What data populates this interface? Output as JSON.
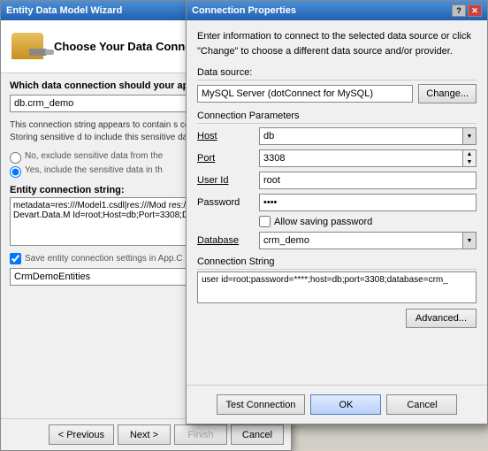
{
  "wizard": {
    "title": "Entity Data Model Wizard",
    "titlebar_buttons": [
      "?",
      "—",
      "✕"
    ],
    "header_title": "Choose Your Data Connection",
    "section_label": "Which data connection should your applic",
    "connection_value": "db.crm_demo",
    "info_text": "This connection string appears to contain s connect to the database. Storing sensitive d to include this sensitive data in the connecti",
    "radio1": "No, exclude sensitive data from the",
    "radio2": "Yes, include the sensitive data in th",
    "entity_label": "Entity connection string:",
    "entity_string": "metadata=res:///Model1.csdl|res:///Mod res:///Model1.msl;provider=Devart.Data.M Id=root;Host=db;Port=3308;Database=crm",
    "save_label": "Save entity connection settings in App.C",
    "app_name": "CrmDemoEntities",
    "footer_buttons": {
      "prev": "< Previous",
      "next": "Next >",
      "finish": "Finish",
      "cancel": "Cancel"
    }
  },
  "dialog": {
    "title": "Connection Properties",
    "titlebar_buttons": [
      "?",
      "✕"
    ],
    "description": "Enter information to connect to the selected data source or click \"Change\" to choose a different data source and/or provider.",
    "datasource_label": "Data source:",
    "datasource_value": "MySQL Server (dotConnect for MySQL)",
    "change_btn": "Change...",
    "conn_params_label": "Connection Parameters",
    "host_label": "Host",
    "host_value": "db",
    "port_label": "Port",
    "port_value": "3308",
    "userid_label": "User Id",
    "userid_value": "root",
    "password_label": "Password",
    "password_value": "****",
    "allow_saving_label": "Allow saving password",
    "database_label": "Database",
    "database_value": "crm_demo",
    "conn_string_label": "Connection String",
    "conn_string_value": "user id=root;password=****;host=db;port=3308;database=crm_",
    "advanced_btn": "Advanced...",
    "test_btn": "Test Connection",
    "ok_btn": "OK",
    "cancel_btn": "Cancel"
  }
}
